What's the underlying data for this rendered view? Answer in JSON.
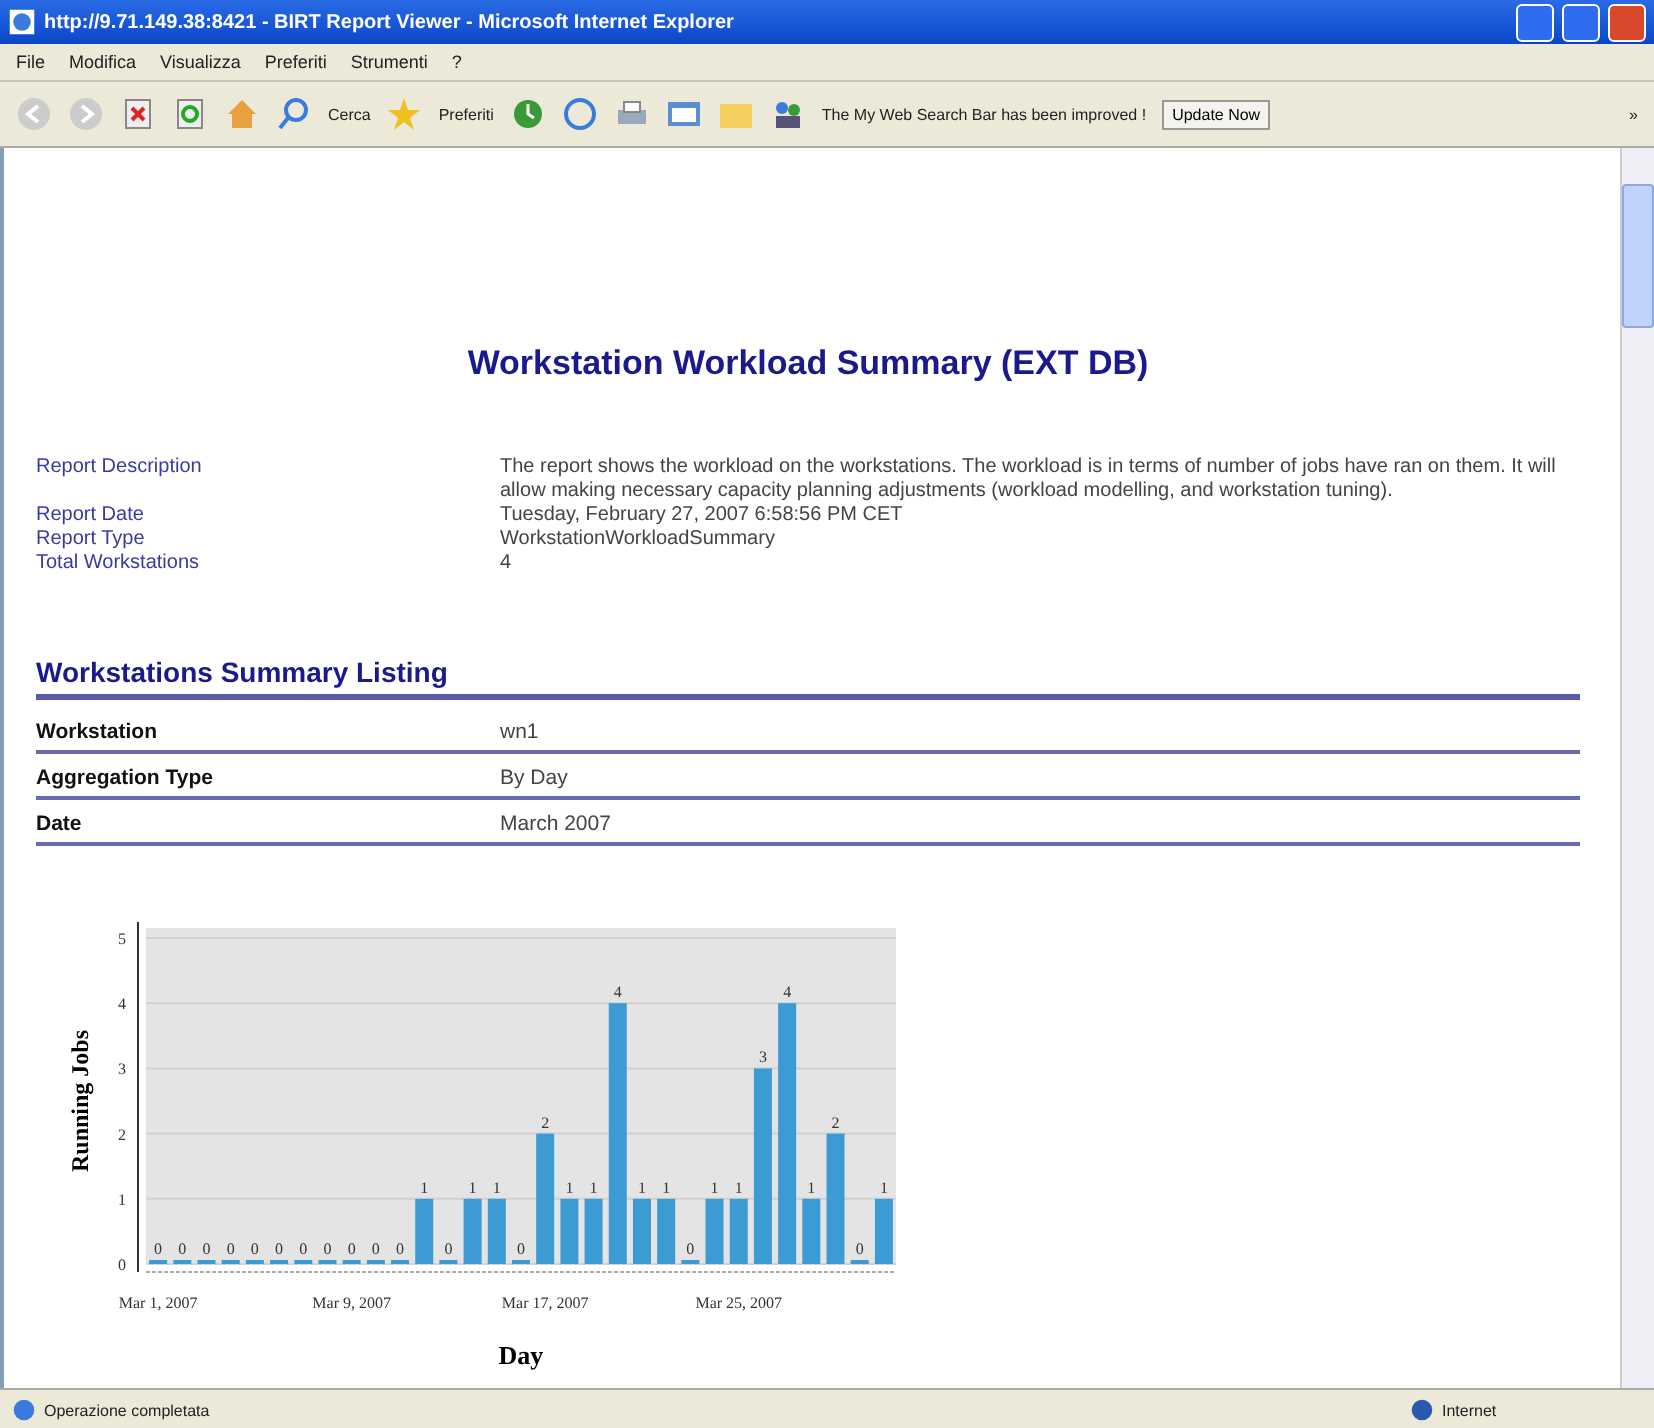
{
  "window": {
    "title": "http://9.71.149.38:8421 - BIRT Report Viewer - Microsoft Internet Explorer"
  },
  "menu": [
    "File",
    "Modifica",
    "Visualizza",
    "Preferiti",
    "Strumenti",
    "?"
  ],
  "toolbar": {
    "search_label": "Cerca",
    "favorites_label": "Preferiti",
    "notice": "The My Web Search Bar has been improved !",
    "update_button": "Update Now",
    "more": "»"
  },
  "report": {
    "title": "Workstation Workload Summary (EXT DB)",
    "fields": [
      {
        "label": "Report Description",
        "value": "The report shows the workload on the workstations. The workload is in terms of number of jobs have ran on them. It will allow making necessary capacity planning adjustments (workload modelling, and workstation tuning)."
      },
      {
        "label": "Report Date",
        "value": "Tuesday, February 27, 2007 6:58:56 PM CET"
      },
      {
        "label": "Report Type",
        "value": "WorkstationWorkloadSummary"
      },
      {
        "label": "Total Workstations",
        "value": "4"
      }
    ],
    "section_title": "Workstations Summary Listing",
    "summary": [
      {
        "label": "Workstation",
        "value": "wn1"
      },
      {
        "label": "Aggregation Type",
        "value": "By Day"
      },
      {
        "label": "Date",
        "value": "March 2007"
      }
    ],
    "chart_data": {
      "type": "bar",
      "xlabel": "Day",
      "ylabel": "Running Jobs",
      "categories": [
        "Mar 1, 2007",
        null,
        null,
        null,
        null,
        null,
        null,
        null,
        "Mar 9, 2007",
        null,
        null,
        null,
        null,
        null,
        null,
        null,
        "Mar 17, 2007",
        null,
        null,
        null,
        null,
        null,
        null,
        null,
        "Mar 25, 2007",
        null,
        null,
        null,
        null,
        null,
        null
      ],
      "series": [
        {
          "color": "#3d9bd4",
          "values": [
            0,
            0,
            0,
            0,
            0,
            0,
            0,
            0,
            0,
            0,
            0,
            1,
            0,
            1,
            1,
            0,
            2,
            1,
            1,
            4,
            1,
            1,
            0,
            1,
            1,
            3,
            4,
            1,
            2,
            0,
            1
          ]
        }
      ],
      "ylim": [
        0,
        5
      ],
      "grid": true,
      "yticks": [
        0,
        1,
        2,
        3,
        4,
        5
      ],
      "data_labels": true
    }
  },
  "status_bar": {
    "message": "Operazione completata",
    "zone": "Internet"
  }
}
